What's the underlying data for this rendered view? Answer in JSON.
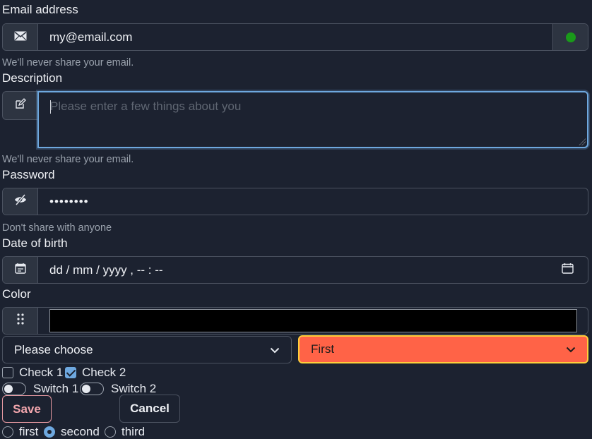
{
  "email": {
    "label": "Email address",
    "value": "my@email.com",
    "help": "We'll never share your email.",
    "status_color": "#1a9a1a"
  },
  "description": {
    "label": "Description",
    "placeholder": "Please enter a few things about you",
    "help": "We'll never share your email."
  },
  "password": {
    "label": "Password",
    "value": "••••••••",
    "help": "Don't share with anyone"
  },
  "dob": {
    "label": "Date of birth",
    "value": "dd / mm / yyyy ,  -- : --"
  },
  "color": {
    "label": "Color",
    "value": "#000000"
  },
  "selects": {
    "first": {
      "value": "Please choose"
    },
    "second": {
      "value": "First",
      "background": "#ff6347",
      "border": "#ffcf3a"
    }
  },
  "checks": [
    {
      "label": "Check 1",
      "checked": false
    },
    {
      "label": "Check 2",
      "checked": true
    }
  ],
  "switches": [
    {
      "label": "Switch 1",
      "on": false
    },
    {
      "label": "Switch 2",
      "on": false
    }
  ],
  "buttons": {
    "save": "Save",
    "cancel": "Cancel"
  },
  "radios": [
    {
      "label": "first",
      "checked": false
    },
    {
      "label": "second",
      "checked": true
    },
    {
      "label": "third",
      "checked": false
    }
  ],
  "icons": {
    "email": "envelope-icon",
    "description": "pencil-square-icon",
    "password": "eye-slash-icon",
    "dob": "calendar-icon",
    "color": "grip-dots-icon"
  }
}
